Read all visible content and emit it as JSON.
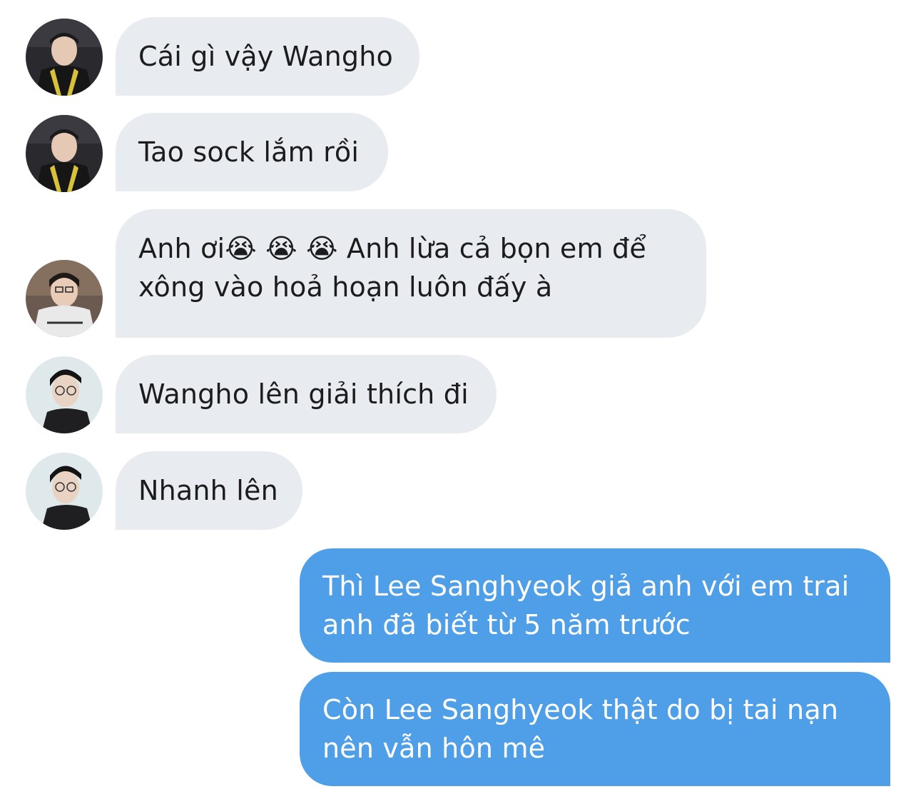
{
  "messages": [
    {
      "sender": "in",
      "avatar": "avatar-photo-1",
      "text": "Cái gì vậy Wangho"
    },
    {
      "sender": "in",
      "avatar": "avatar-photo-1",
      "text": "Tao sock lắm rồi"
    },
    {
      "sender": "in",
      "avatar": "avatar-photo-2",
      "text": "Anh ơi😭 😭 😭 Anh lừa cả bọn em để\nxông vào hoả hoạn luôn đấy à"
    },
    {
      "sender": "in",
      "avatar": "avatar-photo-3",
      "text": "Wangho lên giải thích đi"
    },
    {
      "sender": "in",
      "avatar": "avatar-photo-3",
      "text": "Nhanh lên"
    },
    {
      "sender": "out",
      "text": "Thì Lee Sanghyeok giả anh với em trai\nanh đã biết từ 5 năm trước"
    },
    {
      "sender": "out",
      "text": "Còn Lee Sanghyeok thật do bị tai nạn\nnên vẫn hôn mê"
    }
  ],
  "colors": {
    "incoming_bubble": "#e8ecf0",
    "outgoing_bubble": "#4f9ee8",
    "incoming_text": "#1c1c1e",
    "outgoing_text": "#ffffff"
  }
}
